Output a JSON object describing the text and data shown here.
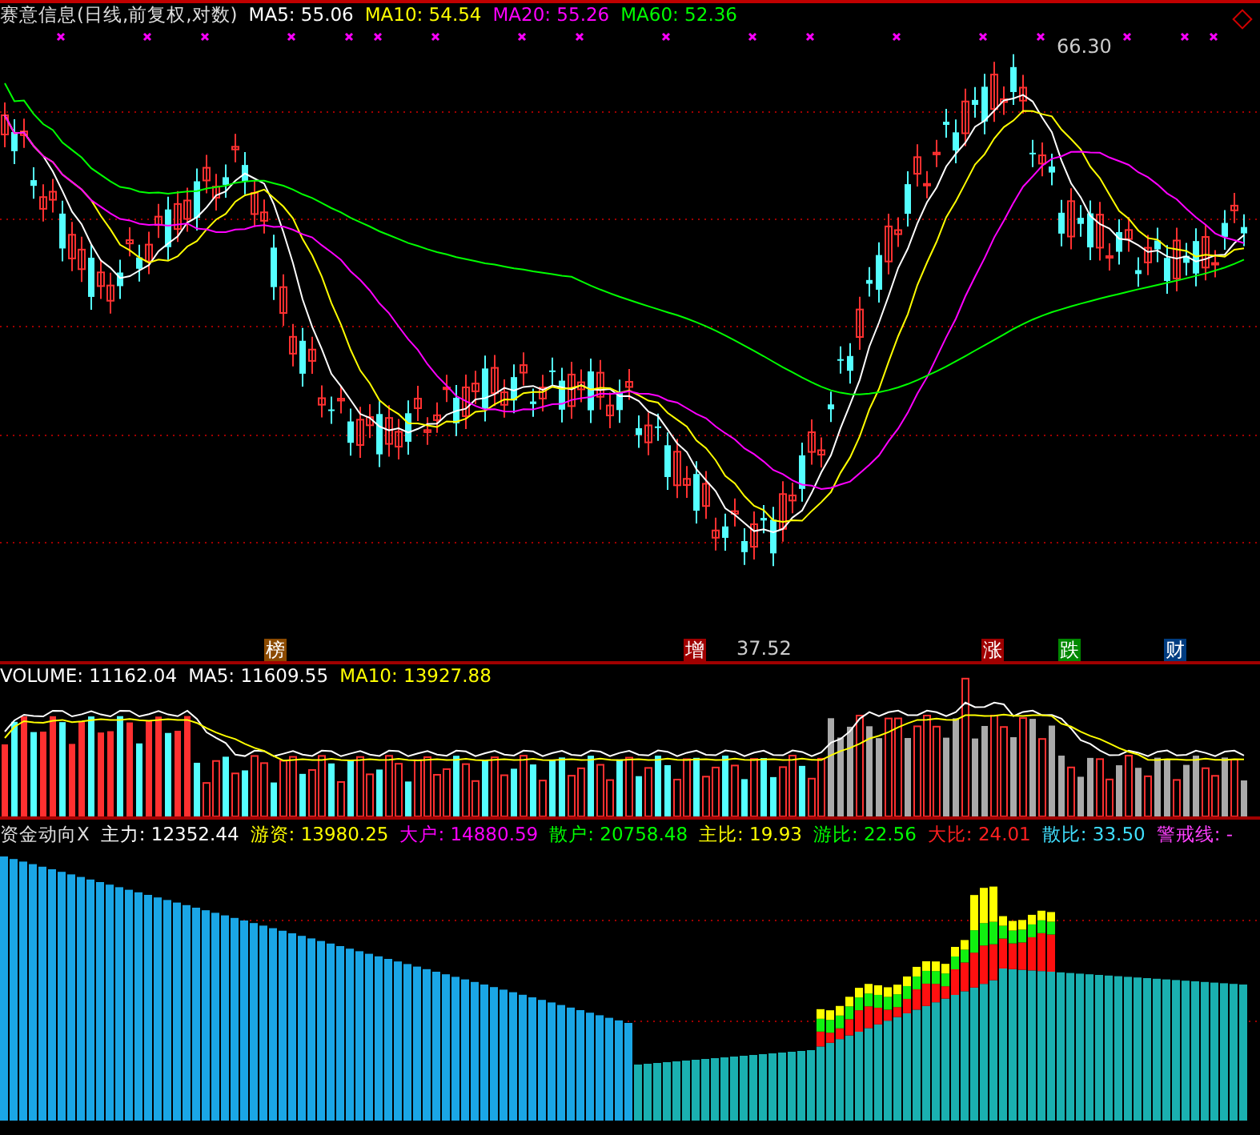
{
  "price_panel": {
    "title": "赛意信息(日线,前复权,对数)",
    "legend": [
      {
        "label": "MA5: 55.06",
        "color": "#ffffff"
      },
      {
        "label": "MA10: 54.54",
        "color": "#ffff00"
      },
      {
        "label": "MA20: 55.26",
        "color": "#ff00ff"
      },
      {
        "label": "MA60: 52.36",
        "color": "#00ff00"
      }
    ],
    "high_label": "66.30",
    "low_label": "37.52",
    "markers": [
      {
        "text": "榜",
        "color": "#8b4a00"
      },
      {
        "text": "增",
        "color": "#a00000"
      },
      {
        "text": "涨",
        "color": "#a00000"
      },
      {
        "text": "跌",
        "color": "#008800"
      },
      {
        "text": "财",
        "color": "#003c80"
      }
    ]
  },
  "volume_panel": {
    "legend": [
      {
        "label": "VOLUME: 11162.04",
        "color": "#ffffff"
      },
      {
        "label": "MA5: 11609.55",
        "color": "#ffffff"
      },
      {
        "label": "MA10: 13927.88",
        "color": "#ffff00"
      }
    ]
  },
  "fund_panel": {
    "title": "资金动向X",
    "legend": [
      {
        "label": "主力: 12352.44",
        "color": "#ffffff"
      },
      {
        "label": "游资: 13980.25",
        "color": "#ffff00"
      },
      {
        "label": "大户: 14880.59",
        "color": "#ff00ff"
      },
      {
        "label": "散户: 20758.48",
        "color": "#00ff00"
      },
      {
        "label": "主比: 19.93",
        "color": "#ffff00"
      },
      {
        "label": "游比: 22.56",
        "color": "#00ff00"
      },
      {
        "label": "大比: 24.01",
        "color": "#ff2020"
      },
      {
        "label": "散比: 33.50",
        "color": "#40e0ff"
      },
      {
        "label": "警戒线: -",
        "color": "#ff40ff"
      }
    ]
  }
}
